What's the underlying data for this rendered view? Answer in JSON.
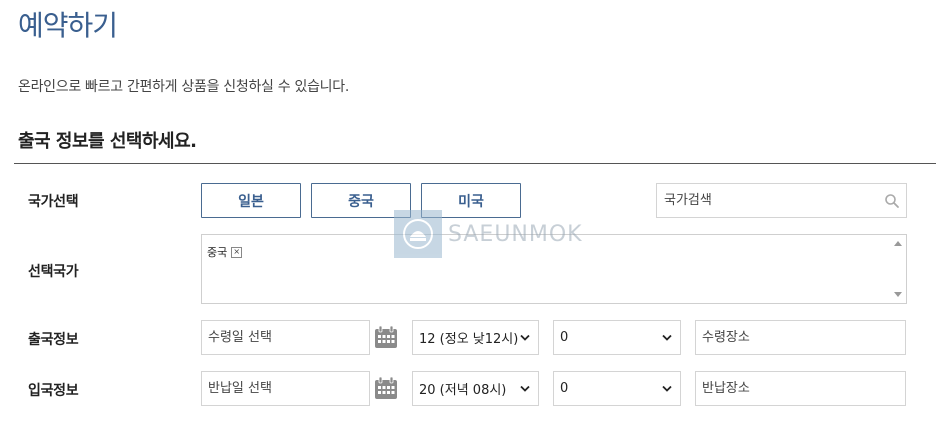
{
  "page": {
    "title": "예약하기",
    "intro": "온라인으로 빠르고 간편하게 상품을 신청하실 수 있습니다.",
    "section_title": "출국 정보를 선택하세요."
  },
  "country_select": {
    "label": "국가선택",
    "buttons": [
      "일본",
      "중국",
      "미국"
    ],
    "search_placeholder": "국가검색",
    "search_icon": "search-icon"
  },
  "selected_countries": {
    "label": "선택국가",
    "chips": [
      {
        "name": "중국",
        "remove": "×"
      }
    ]
  },
  "departure": {
    "label": "출국정보",
    "date_placeholder": "수령일 선택",
    "hour": "12 (정오 낮12시)",
    "minute": "0",
    "place_placeholder": "수령장소"
  },
  "arrival": {
    "label": "입국정보",
    "date_placeholder": "반납일 선택",
    "hour": "20 (저녁 08시)",
    "minute": "0",
    "place_placeholder": "반납장소"
  },
  "watermark": {
    "text": "SAEUNMOK"
  },
  "colors": {
    "accent": "#3a5f8f",
    "border": "#4a6b91",
    "calendar": "#8a8a8a"
  }
}
